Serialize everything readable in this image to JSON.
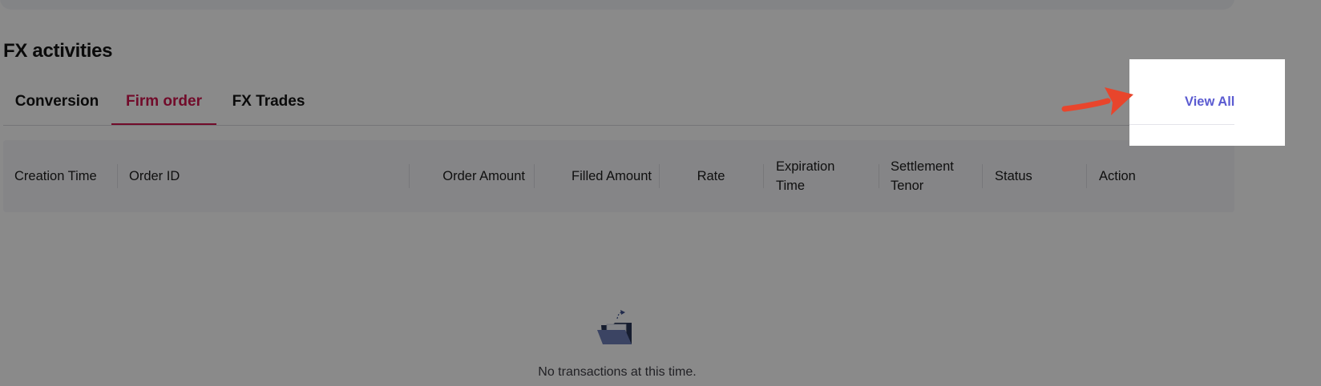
{
  "section": {
    "title": "FX activities"
  },
  "tabs": [
    {
      "label": "Conversion",
      "active": false
    },
    {
      "label": "Firm order",
      "active": true
    },
    {
      "label": "FX Trades",
      "active": false
    }
  ],
  "view_all": {
    "label": "View All"
  },
  "table": {
    "columns": [
      "Creation Time",
      "Order ID",
      "Order Amount",
      "Filled Amount",
      "Rate",
      "Expiration Time",
      "Settlement Tenor",
      "Status",
      "Action"
    ],
    "rows": []
  },
  "empty_state": {
    "icon": "empty-folder-icon",
    "message": "No transactions at this time."
  },
  "colors": {
    "active_tab": "#d1164f",
    "link": "#5b5bd1",
    "overlay": "rgba(0,0,0,0.46)",
    "pointer_arrow": "#e8452c"
  }
}
